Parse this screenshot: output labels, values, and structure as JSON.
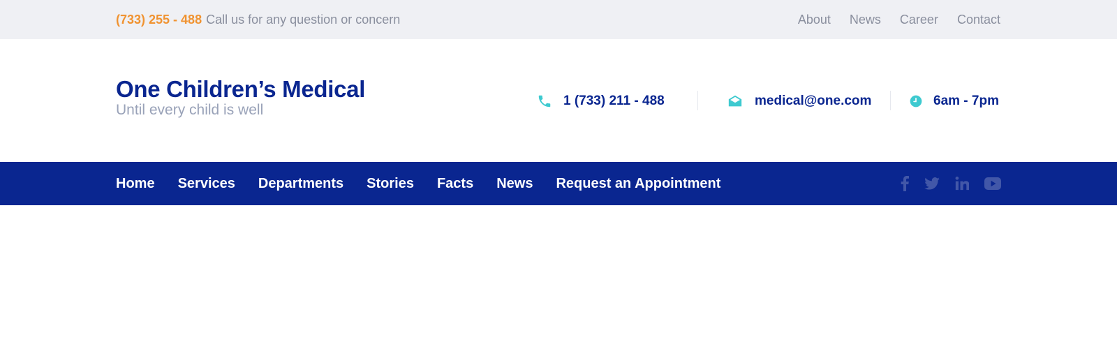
{
  "topbar": {
    "phone": "(733) 255 - 488",
    "tagline": "Call us for any question or concern",
    "links": [
      "About",
      "News",
      "Career",
      "Contact"
    ]
  },
  "brand": {
    "title": "One Children’s Medical",
    "tagline": "Until every child is well"
  },
  "contact": {
    "phone": "1 (733) 211 - 488",
    "email": "medical@one.com",
    "hours": "6am - 7pm"
  },
  "nav": {
    "items": [
      "Home",
      "Services",
      "Departments",
      "Stories",
      "Facts",
      "News",
      "Request an Appointment"
    ]
  },
  "social": {
    "icons": [
      "facebook-icon",
      "twitter-icon",
      "linkedin-icon",
      "youtube-icon"
    ]
  },
  "colors": {
    "brand_blue": "#0a2690",
    "accent_orange": "#f09331",
    "accent_teal": "#3ecad0",
    "topbar_bg": "#eff0f4",
    "muted_text": "#8a8f9e",
    "tagline_gray": "#99a2b8",
    "social_icon": "#4257a8"
  }
}
